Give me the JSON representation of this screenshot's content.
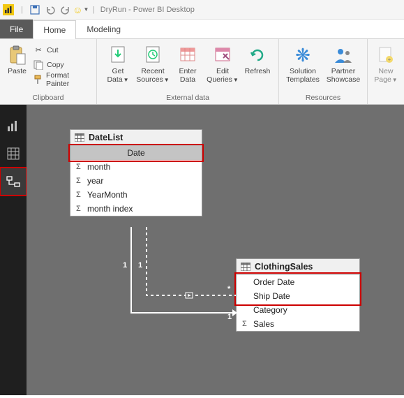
{
  "title": "DryRun - Power BI Desktop",
  "tabs": {
    "file": "File",
    "home": "Home",
    "modeling": "Modeling"
  },
  "clipboard": {
    "group": "Clipboard",
    "paste": "Paste",
    "cut": "Cut",
    "copy": "Copy",
    "format_painter": "Format Painter"
  },
  "external": {
    "group": "External data",
    "get_data": "Get\nData",
    "recent_sources": "Recent\nSources",
    "enter_data": "Enter\nData",
    "edit_queries": "Edit\nQueries",
    "refresh": "Refresh"
  },
  "resources": {
    "group": "Resources",
    "solution_templates": "Solution\nTemplates",
    "partner_showcase": "Partner\nShowcase"
  },
  "newpage": "New\nPage",
  "tables": {
    "datelist": {
      "title": "DateList",
      "fields": [
        "Date",
        "month",
        "year",
        "YearMonth",
        "month index"
      ]
    },
    "clothing": {
      "title": "ClothingSales",
      "fields": [
        "Order Date",
        "Ship Date",
        "Category",
        "Sales"
      ]
    }
  },
  "card": {
    "one_a": "1",
    "one_b": "1",
    "one_c": "1",
    "many": "*"
  }
}
